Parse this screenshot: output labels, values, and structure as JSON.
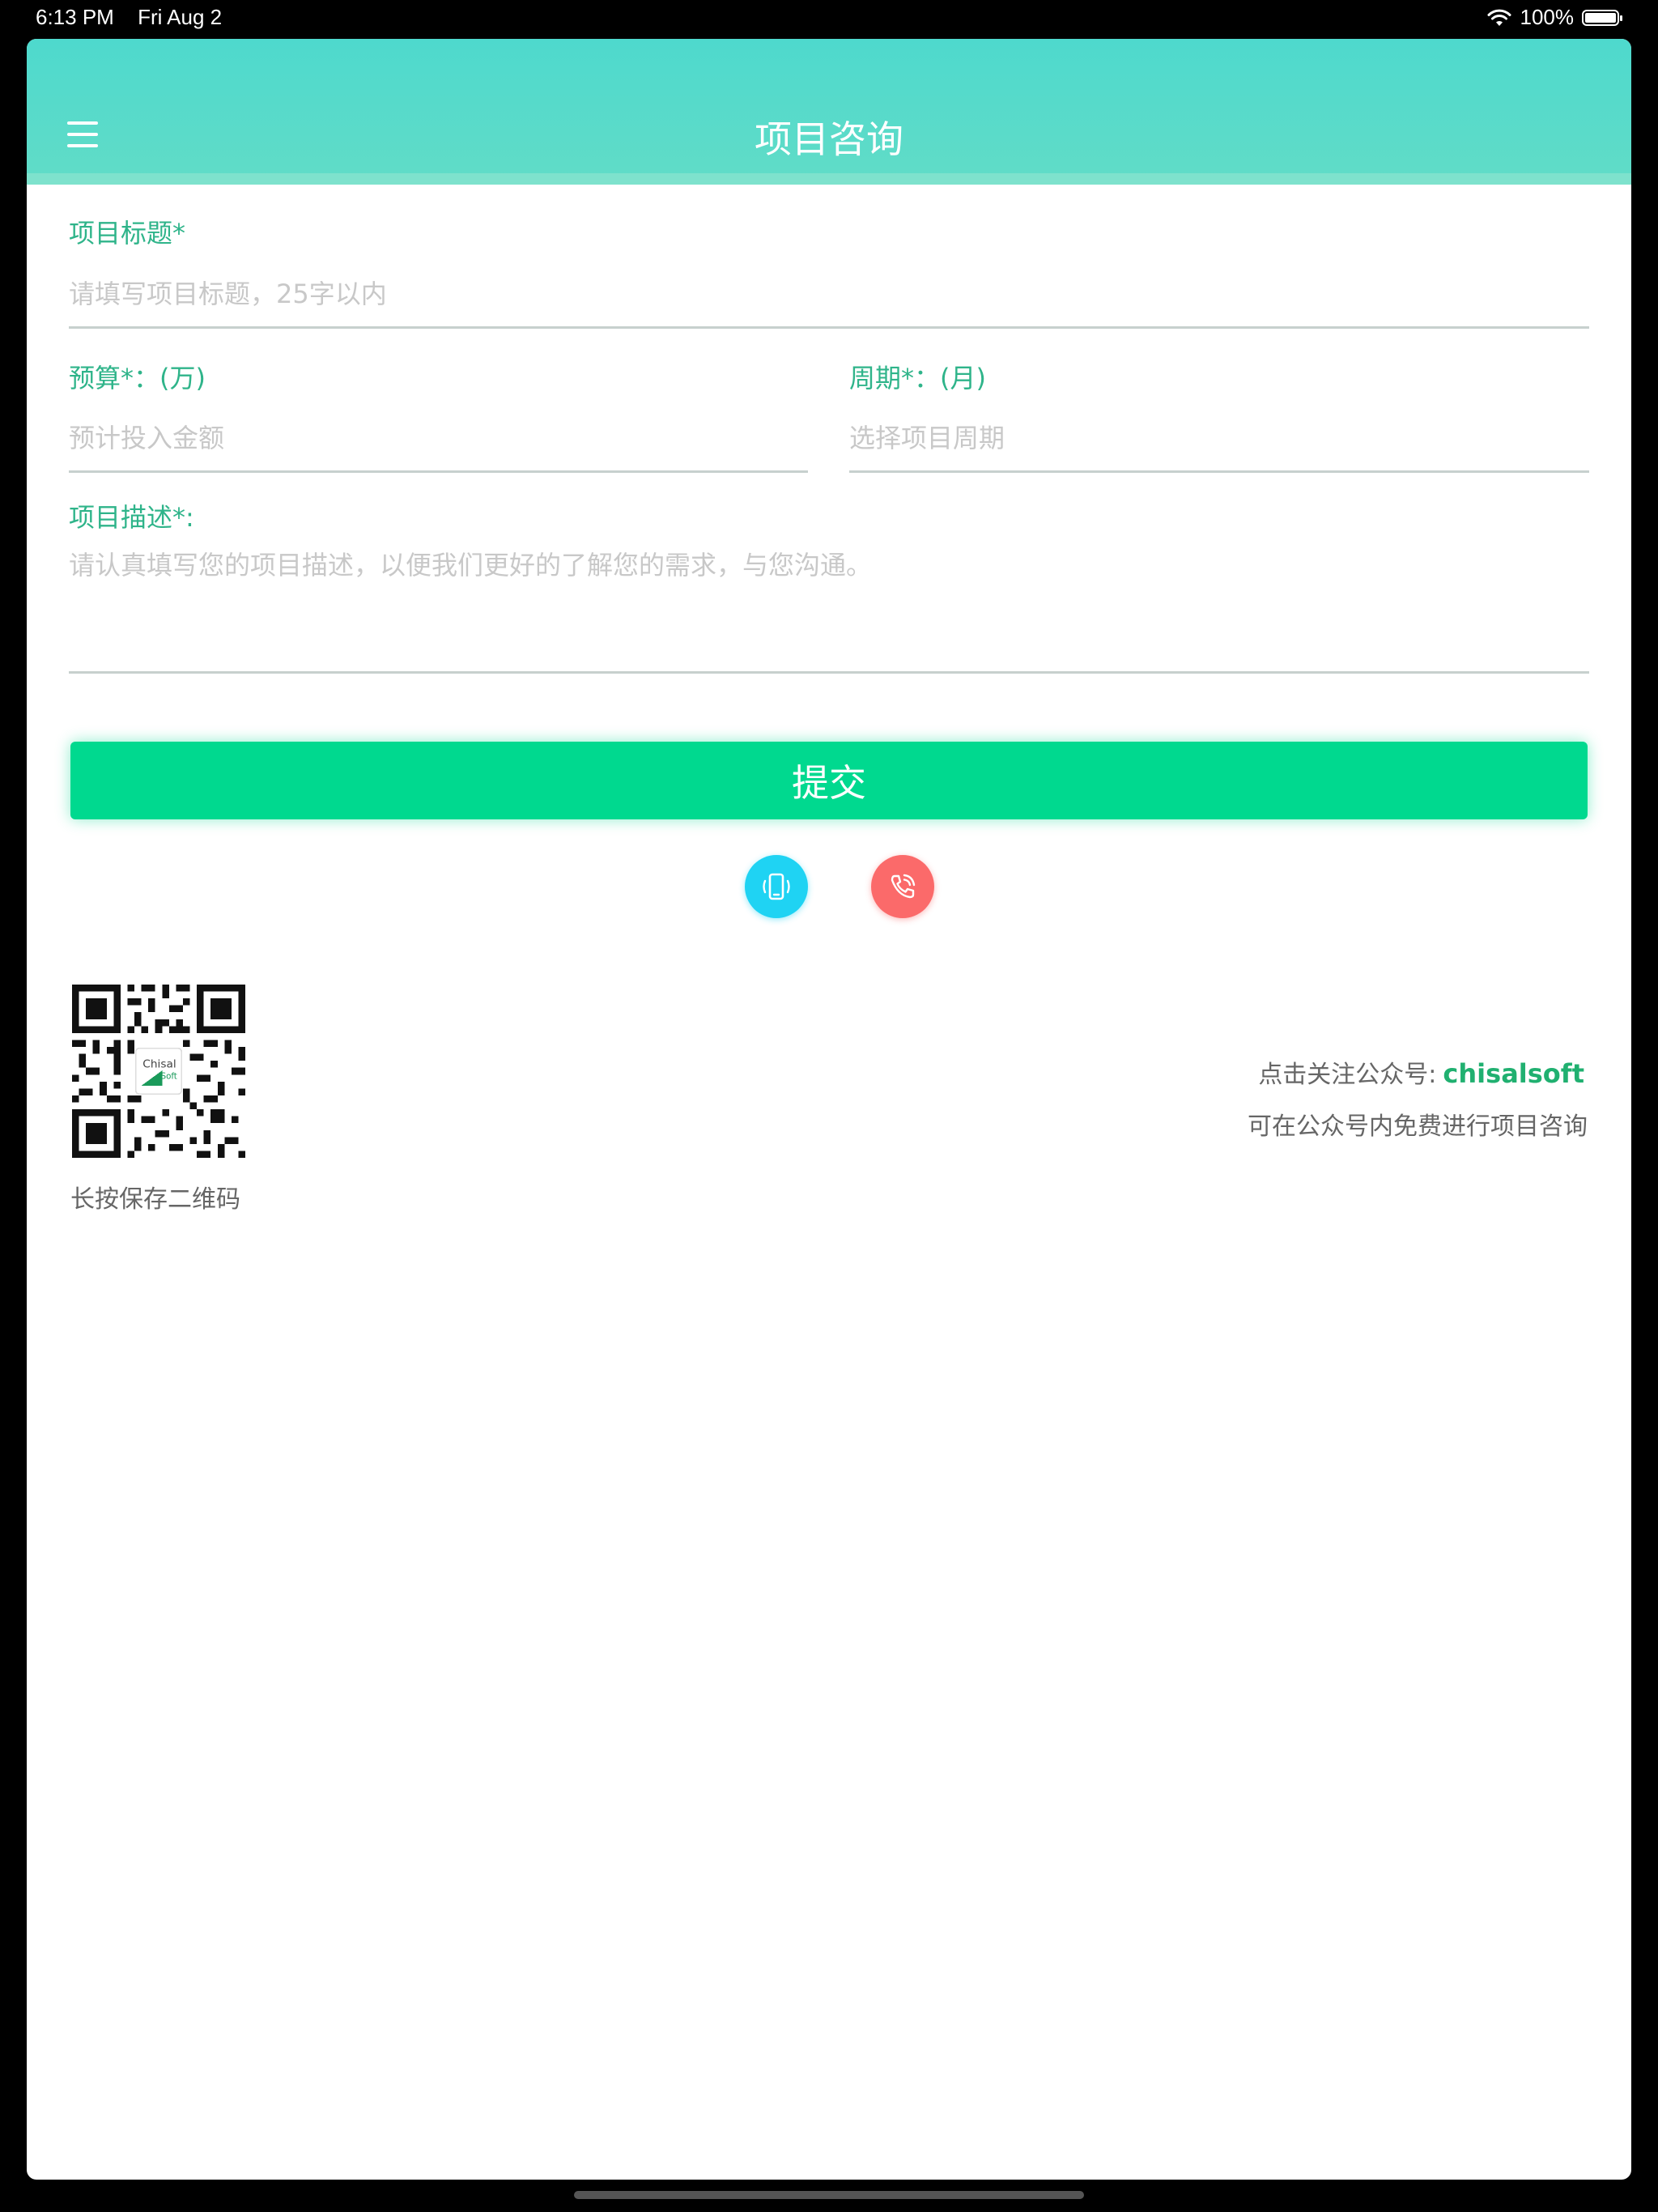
{
  "status_bar": {
    "time": "6:13 PM",
    "date": "Fri Aug 2",
    "battery": "100%"
  },
  "header": {
    "title": "项目咨询",
    "menu_icon": "hamburger-menu-icon"
  },
  "form": {
    "title_label": "项目标题*",
    "title_placeholder": "请填写项目标题，25字以内",
    "budget_label": "预算*：(万)",
    "budget_placeholder": "预计投入金额",
    "period_label": "周期*：(月)",
    "period_placeholder": "选择项目周期",
    "description_label": "项目描述*:",
    "description_placeholder": "请认真填写您的项目描述，以便我们更好的了解您的需求，与您沟通。",
    "submit_label": "提交"
  },
  "contact": {
    "mobile_icon": "mobile-phone-icon",
    "phone_icon": "phone-call-icon"
  },
  "footer": {
    "qr_caption": "长按保存二维码",
    "qr_logo_text": "Chisal",
    "qr_logo_sub": "Soft",
    "follow_text": "点击关注公众号:",
    "follow_account": "chisalsoft",
    "follow_note": "可在公众号内免费进行项目咨询"
  },
  "colors": {
    "accent": "#2fb48a",
    "header": "#4ed9cd",
    "submit": "#00d98f",
    "mobile_button": "#1fd3f3",
    "phone_button": "#fb6a6a"
  }
}
